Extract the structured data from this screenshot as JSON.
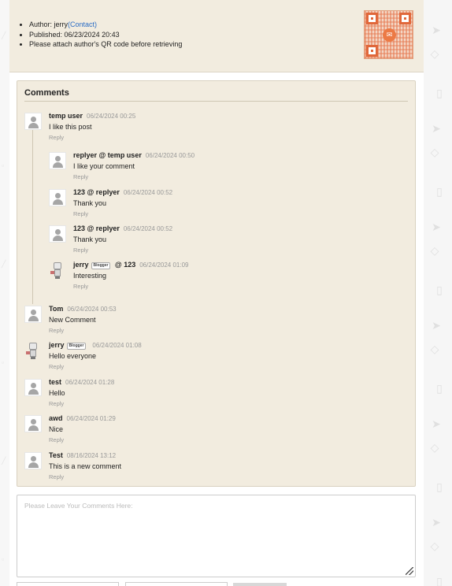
{
  "post_info": {
    "author_label": "Author: jerry",
    "contact_link": "(Contact)",
    "published": "Published: 06/23/2024 20:43",
    "qr_note": "Please attach author's QR code before retrieving"
  },
  "comments": {
    "title": "Comments",
    "reply_label": "Reply",
    "badge_label": "Blogger",
    "items": [
      {
        "author": "temp user",
        "to": "",
        "badge": false,
        "date": "06/24/2024 00:25",
        "text": "I like this post",
        "avatar": "default"
      },
      {
        "author": "replyer",
        "to": " @ temp user",
        "badge": false,
        "date": "06/24/2024 00:50",
        "text": "I like your comment",
        "avatar": "default"
      },
      {
        "author": "123",
        "to": " @ replyer",
        "badge": false,
        "date": "06/24/2024 00:52",
        "text": "Thank you",
        "avatar": "default"
      },
      {
        "author": "123",
        "to": " @ replyer",
        "badge": false,
        "date": "06/24/2024 00:52",
        "text": "Thank you",
        "avatar": "default"
      },
      {
        "author": "jerry",
        "to": " @ 123",
        "badge": true,
        "date": "06/24/2024 01:09",
        "text": "Interesting",
        "avatar": "robot"
      },
      {
        "author": "Tom",
        "to": "",
        "badge": false,
        "date": "06/24/2024 00:53",
        "text": "New Comment",
        "avatar": "default"
      },
      {
        "author": "jerry",
        "to": "",
        "badge": true,
        "date": "06/24/2024 01:08",
        "text": "Hello everyone",
        "avatar": "robot"
      },
      {
        "author": "test",
        "to": "",
        "badge": false,
        "date": "06/24/2024 01:28",
        "text": "Hello",
        "avatar": "default"
      },
      {
        "author": "awd",
        "to": "",
        "badge": false,
        "date": "06/24/2024 01:29",
        "text": "Nice",
        "avatar": "default"
      },
      {
        "author": "Test",
        "to": "",
        "badge": false,
        "date": "08/16/2024 13:12",
        "text": "This is a new comment",
        "avatar": "default"
      }
    ]
  },
  "comment_form": {
    "placeholder": "Please Leave Your Comments Here:"
  },
  "colors": {
    "panel_bg": "#f2ecdf",
    "link": "#2a6cc4",
    "qr_accent": "#e0673a"
  },
  "icons": [
    "qr-code-icon",
    "user-avatar-icon",
    "robot-avatar-icon",
    "resize-grip-icon"
  ]
}
